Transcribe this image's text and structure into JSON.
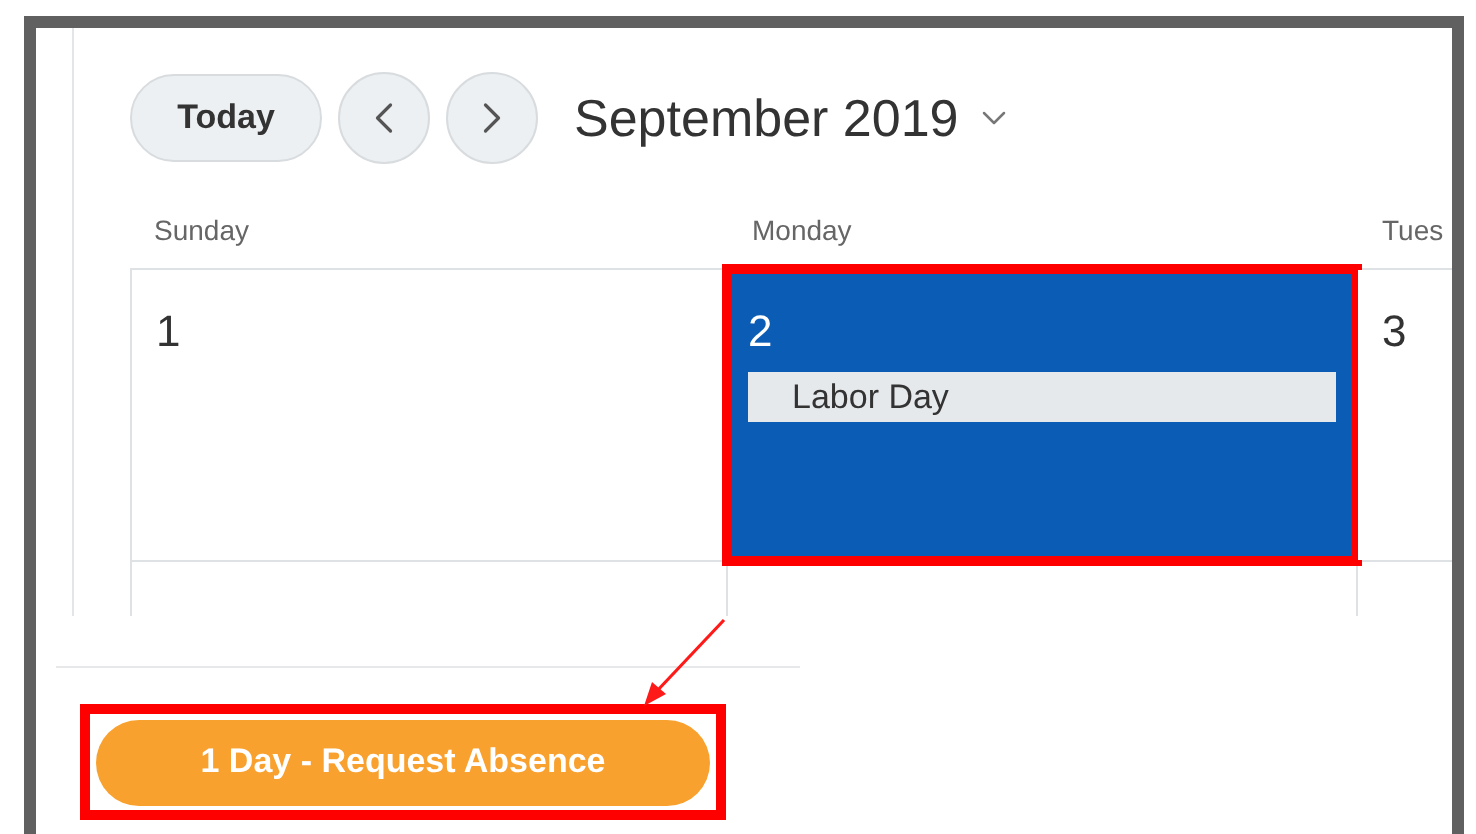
{
  "toolbar": {
    "today": "Today",
    "month": "September 2019"
  },
  "weekdays": [
    "Sunday",
    "Monday",
    "Tues"
  ],
  "days": [
    {
      "number": "1",
      "selected": false
    },
    {
      "number": "2",
      "selected": true,
      "events": [
        "Labor Day"
      ]
    },
    {
      "number": "3",
      "selected": false
    }
  ],
  "action_button": "1 Day - Request Absence"
}
